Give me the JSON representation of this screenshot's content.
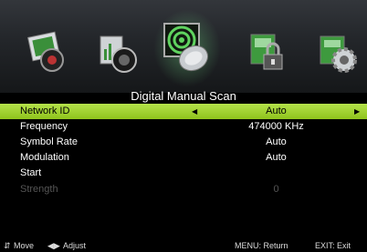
{
  "menu_tabs": [
    {
      "name": "picture"
    },
    {
      "name": "sound"
    },
    {
      "name": "channel"
    },
    {
      "name": "lock"
    },
    {
      "name": "setup"
    }
  ],
  "title": "Digital Manual Scan",
  "rows": [
    {
      "label": "Network ID",
      "value": "Auto"
    },
    {
      "label": "Frequency",
      "value": "474000 KHz"
    },
    {
      "label": "Symbol Rate",
      "value": "Auto"
    },
    {
      "label": "Modulation",
      "value": "Auto"
    },
    {
      "label": "Start",
      "value": ""
    },
    {
      "label": "Strength",
      "value": "0"
    }
  ],
  "footer": {
    "move": "Move",
    "adjust": "Adjust",
    "menu_return": "MENU: Return",
    "exit": "EXIT: Exit"
  },
  "colors": {
    "highlight": "#a6d62e",
    "disabled": "#555555",
    "background": "#000000"
  }
}
